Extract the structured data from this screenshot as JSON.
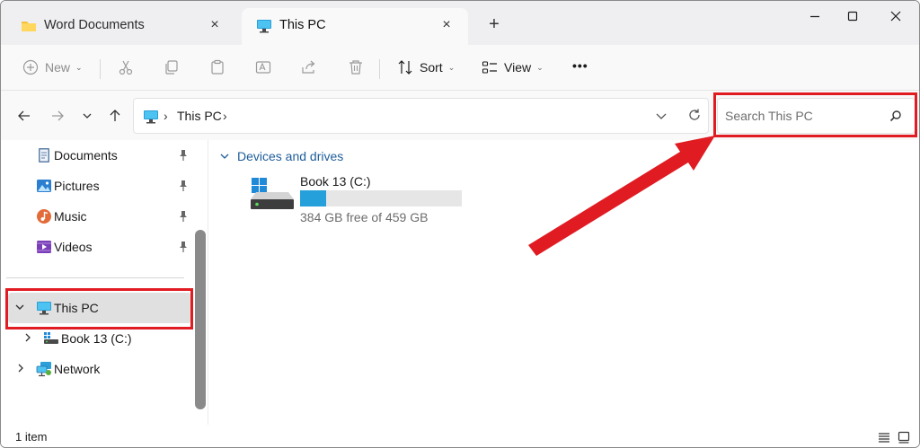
{
  "tabs": [
    {
      "title": "Word Documents",
      "active": false,
      "icon": "folder-icon",
      "close": "×"
    },
    {
      "title": "This PC",
      "active": true,
      "icon": "monitor-icon",
      "close": "×"
    }
  ],
  "new_tab_label": "+",
  "toolbar": {
    "new_label": "New",
    "sort_label": "Sort",
    "view_label": "View",
    "more_label": "•••",
    "icons": [
      "cut-icon",
      "copy-icon",
      "paste-icon",
      "rename-icon",
      "share-icon",
      "delete-icon"
    ]
  },
  "address": {
    "crumbs": [
      "This PC"
    ],
    "separator": "›"
  },
  "search": {
    "placeholder": "Search This PC"
  },
  "sidebar": {
    "quick_access": [
      {
        "label": "Documents",
        "icon": "documents-icon",
        "pinned": true
      },
      {
        "label": "Pictures",
        "icon": "pictures-icon",
        "pinned": true
      },
      {
        "label": "Music",
        "icon": "music-icon",
        "pinned": true
      },
      {
        "label": "Videos",
        "icon": "videos-icon",
        "pinned": true
      }
    ],
    "this_pc": {
      "label": "This PC",
      "icon": "monitor-icon",
      "expanded": true,
      "selected": true
    },
    "drive": {
      "label": "Book 13 (C:)",
      "icon": "drive-icon"
    },
    "network": {
      "label": "Network",
      "icon": "network-icon"
    }
  },
  "main": {
    "group_label": "Devices and drives",
    "drives": [
      {
        "name": "Book 13 (C:)",
        "free_text": "384 GB free of 459 GB",
        "free_gb": 384,
        "total_gb": 459
      }
    ]
  },
  "status": {
    "item_count": "1 item"
  },
  "colors": {
    "accent": "#26a0da",
    "highlight": "#e01b22",
    "group_header": "#1e5d9a"
  }
}
